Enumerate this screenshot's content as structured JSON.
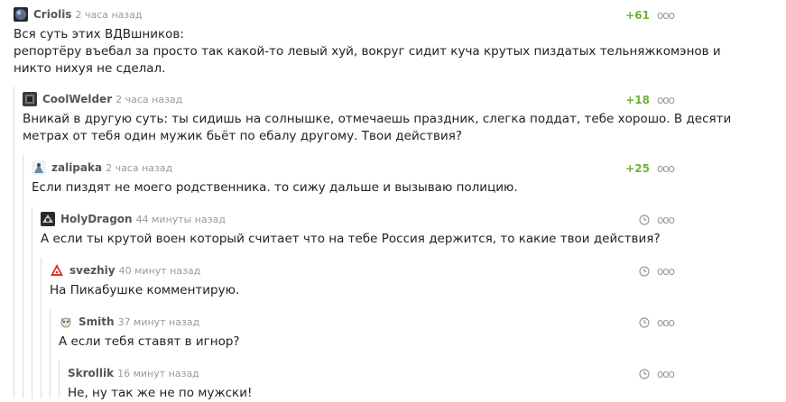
{
  "comments": [
    {
      "author": "Criolis",
      "time": "2 часа назад",
      "rating": "+61",
      "text": "Вся суть этих ВДВшников:\nрепортёру въебал за просто так какой-то левый хуй, вокруг сидит куча крутых пиздатых тельняжкомэнов и\nникто нихуя не сделал."
    },
    {
      "author": "CoolWelder",
      "time": "2 часа назад",
      "rating": "+18",
      "text": "Вникай в другую суть: ты сидишь на солнышке, отмечаешь праздник, слегка поддат, тебе хорошо. В десяти\nметрах от тебя один мужик бьёт по ебалу другому. Твои действия?"
    },
    {
      "author": "zalipaka",
      "time": "2 часа назад",
      "rating": "+25",
      "text": "Если пиздят не моего родственника. то сижу дальше и вызываю полицию."
    },
    {
      "author": "HolyDragon",
      "time": "44 минуты назад",
      "text": "А если ты крутой воен который считает что на тебе Россия держится, то какие твои действия?"
    },
    {
      "author": "svezhiy",
      "time": "40 минут назад",
      "text": "На Пикабушке комментирую."
    },
    {
      "author": "Smith",
      "time": "37 минут назад",
      "text": "А если тебя ставят в игнор?"
    },
    {
      "author": "Skrollik",
      "time": "16 минут назад",
      "text": "Не, ну так же не по мужски!"
    }
  ],
  "more_glyph": "ооо",
  "colors": {
    "rating": "#6cb23a",
    "meta": "#9a9a9a",
    "author": "#555555"
  },
  "icons": [
    "more-icon",
    "clock-icon"
  ]
}
